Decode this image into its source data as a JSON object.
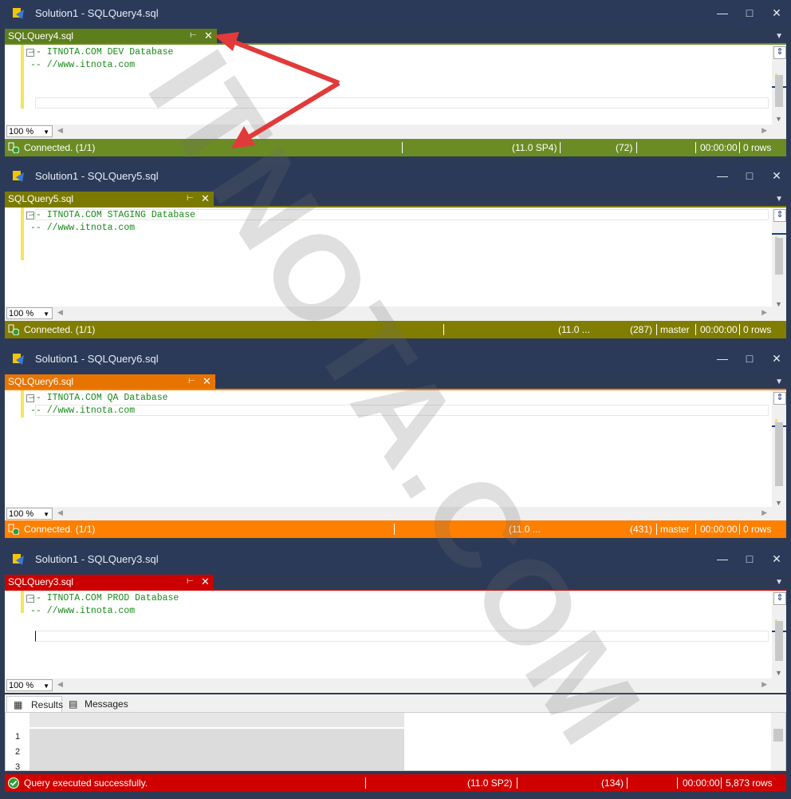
{
  "windows": [
    {
      "title": "Solution1 - SQLQuery4.sql",
      "tab": "SQLQuery4.sql",
      "tab_color": "#5e7d1c",
      "status_color": "#6b8c24",
      "lines": [
        "-- ITNOTA.COM DEV Database",
        "-- //www.itnota.com"
      ],
      "zoom": "100 %",
      "status": {
        "text": "Connected. (1/1)",
        "version": "(11.0 SP4)",
        "spid": "(72)",
        "db": "",
        "time": "00:00:00",
        "rows": "0 rows"
      }
    },
    {
      "title": "Solution1 - SQLQuery5.sql",
      "tab": "SQLQuery5.sql",
      "tab_color": "#7a7a00",
      "status_color": "#807d00",
      "lines": [
        "-- ITNOTA.COM STAGING Database",
        "-- //www.itnota.com"
      ],
      "zoom": "100 %",
      "status": {
        "text": "Connected. (1/1)",
        "version": "(11.0 ...",
        "spid": "(287)",
        "db": "master",
        "time": "00:00:00",
        "rows": "0 rows"
      }
    },
    {
      "title": "Solution1 - SQLQuery6.sql",
      "tab": "SQLQuery6.sql",
      "tab_color": "#e87400",
      "status_color": "#ff7f00",
      "lines": [
        "-- ITNOTA.COM QA Database",
        "-- //www.itnota.com"
      ],
      "zoom": "100 %",
      "status": {
        "text": "Connected. (1/1)",
        "version": "(11.0 ...",
        "spid": "(431)",
        "db": "master",
        "time": "00:00:00",
        "rows": "0 rows"
      }
    },
    {
      "title": "Solution1 - SQLQuery3.sql",
      "tab": "SQLQuery3.sql",
      "tab_color": "#cc0000",
      "status_color": "#d00000",
      "lines": [
        "-- ITNOTA.COM PROD Database",
        "-- //www.itnota.com"
      ],
      "zoom": "100 %",
      "status": {
        "text": "Query executed successfully.",
        "version": "(11.0 SP2)",
        "spid": "(134)",
        "db": "",
        "time": "00:00:00",
        "rows": "5,873 rows"
      }
    }
  ],
  "results_tabs": {
    "results": "Results",
    "messages": "Messages"
  },
  "row_numbers": [
    "1",
    "2",
    "3"
  ],
  "watermark": "ITNOTA.COM"
}
